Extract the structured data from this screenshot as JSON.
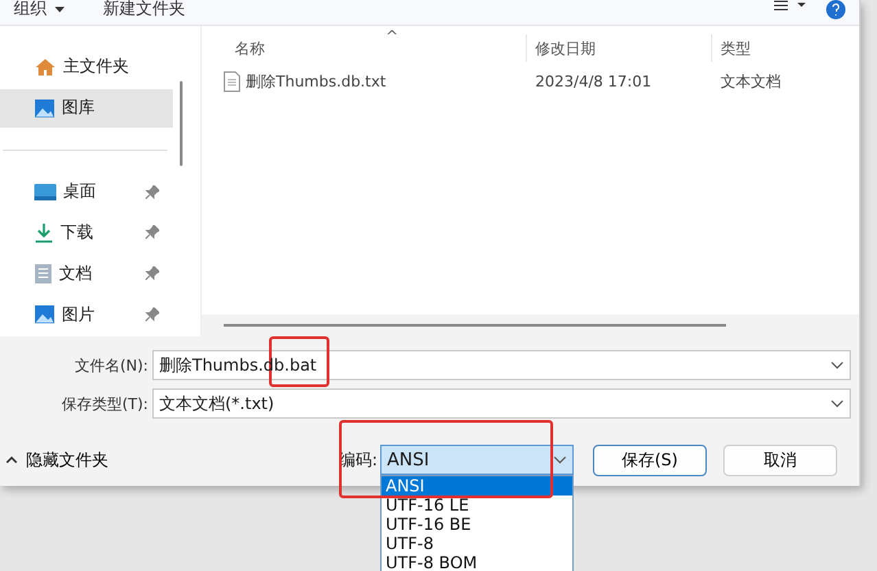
{
  "toolbar": {
    "organize": "组织",
    "new_folder": "新建文件夹"
  },
  "nav": {
    "quick": [
      {
        "label": "主文件夹",
        "kind": "home",
        "selected": false
      },
      {
        "label": "图库",
        "kind": "gallery",
        "selected": true
      }
    ],
    "pinned": [
      {
        "label": "桌面",
        "kind": "desktop",
        "pinned": true
      },
      {
        "label": "下载",
        "kind": "download",
        "pinned": true
      },
      {
        "label": "文档",
        "kind": "document",
        "pinned": true
      },
      {
        "label": "图片",
        "kind": "pictures",
        "pinned": true
      }
    ]
  },
  "file_list": {
    "sort_indicator": "^",
    "columns": [
      "名称",
      "修改日期",
      "类型"
    ],
    "rows": [
      {
        "name": "删除Thumbs.db.txt",
        "date": "2023/4/8 17:01",
        "type": "文本文档"
      }
    ]
  },
  "file_name": {
    "label": "文件名(N):",
    "value": "删除Thumbs.db.bat",
    "highlighted": true
  },
  "save_type": {
    "label": "保存类型(T):",
    "value": "文本文档(*.txt)"
  },
  "hide_folders": "隐藏文件夹",
  "encoding": {
    "label": "编码:",
    "value": "ANSI",
    "expanded": true,
    "highlighted": true,
    "options": [
      {
        "label": "ANSI",
        "selected": true
      },
      {
        "label": "UTF-16 LE",
        "selected": false
      },
      {
        "label": "UTF-16 BE",
        "selected": false
      },
      {
        "label": "UTF-8",
        "selected": false
      },
      {
        "label": "UTF-8 BOM",
        "selected": false
      }
    ]
  },
  "buttons": [
    {
      "label": "保存(S)",
      "kind": "primary"
    },
    {
      "label": "取消",
      "kind": "secondary"
    }
  ]
}
